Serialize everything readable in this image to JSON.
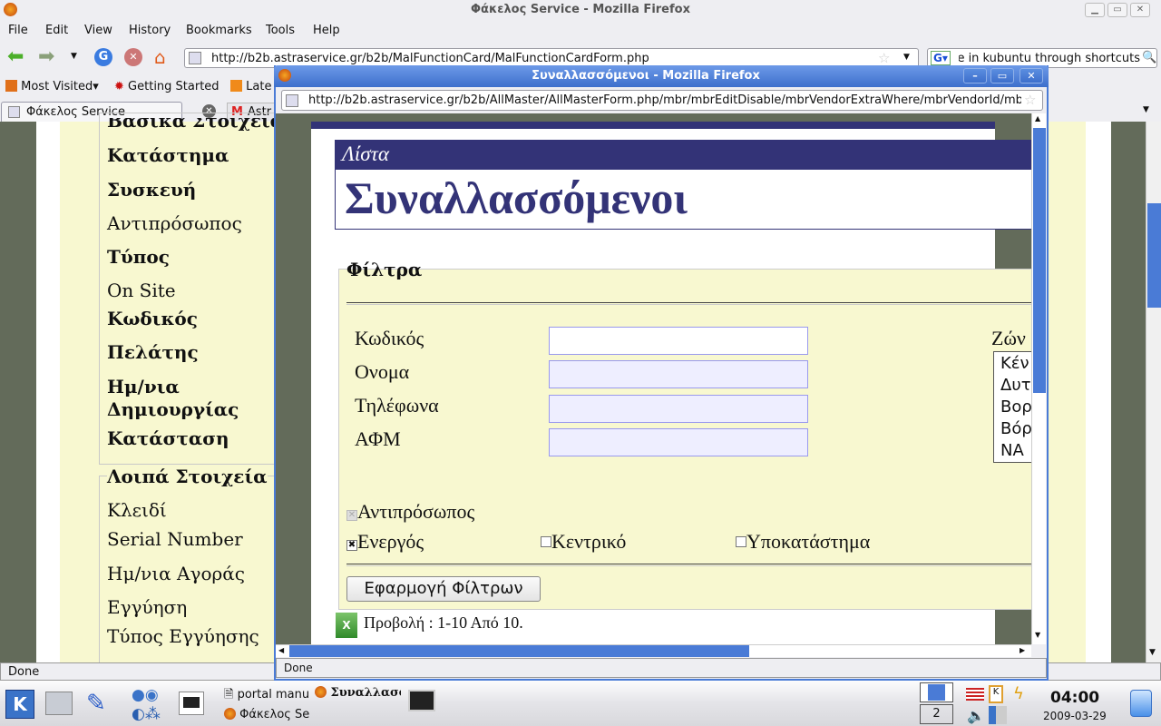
{
  "main_window": {
    "title": "Φάκελος Service - Mozilla Firefox",
    "menu": [
      "File",
      "Edit",
      "View",
      "History",
      "Bookmarks",
      "Tools",
      "Help"
    ],
    "url": "http://b2b.astraservice.gr/b2b/MalFunctionCard/MalFunctionCardForm.php",
    "search_value": "e in kubuntu through shortcuts",
    "bookmarks": [
      "Most Visited",
      "Getting Started",
      "Late"
    ],
    "tabs": [
      "Φάκελος Service",
      "Astr"
    ],
    "status": "Done",
    "sidebar_group1": {
      "legend": "Βασικά Στοιχεία",
      "items": [
        {
          "label": "Κατάστημα",
          "bold": true
        },
        {
          "label": "Συσκευή",
          "bold": true
        },
        {
          "label": "Αντιπρόσωπος",
          "bold": false
        },
        {
          "label": "Τύπος",
          "bold": true
        },
        {
          "label": "On Site",
          "bold": false
        },
        {
          "label": "Κωδικός",
          "bold": true
        },
        {
          "label": "Πελάτης",
          "bold": true
        },
        {
          "label": "Ημ/νια",
          "bold": true
        },
        {
          "label": "Δημιουργίας",
          "bold": true
        },
        {
          "label": "Κατάσταση",
          "bold": true
        }
      ]
    },
    "sidebar_group2": {
      "legend": "Λοιπά Στοιχεία",
      "items": [
        "Κλειδί",
        "Serial Number",
        "Ημ/νια Αγοράς",
        "Εγγύηση",
        "Τύπος Εγγύησης"
      ]
    }
  },
  "popup": {
    "title": "Συναλλασσόμενοι - Mozilla Firefox",
    "url": "http://b2b.astraservice.gr/b2b/AllMaster/AllMasterForm.php/mbr/mbrEditDisable/mbrVendorExtraWhere/mbrVendorId/mbrVendo",
    "banner": "Λίστα",
    "heading": "Συναλλασσόμενοι",
    "filters": {
      "legend": "Φίλτρα",
      "fields": [
        {
          "label": "Κωδικός",
          "value": ""
        },
        {
          "label": "Ονομα",
          "value": ""
        },
        {
          "label": "Τηλέφωνα",
          "value": ""
        },
        {
          "label": "ΑΦΜ",
          "value": ""
        }
      ],
      "zone_label": "Ζών",
      "zone_options": [
        "Κέν",
        "Δυτ",
        "Βορ",
        "Βόρ",
        "NA"
      ],
      "checkboxes": [
        {
          "label": "Αντιπρόσωπος",
          "checked": true,
          "disabled": true
        },
        {
          "label": "Ενεργός",
          "checked": true
        },
        {
          "label": "Κεντρικό",
          "checked": false
        },
        {
          "label": "Υποκατάστημα",
          "checked": false
        }
      ],
      "apply_button": "Εφαρμογή Φίλτρων"
    },
    "paging": "Προβολή : 1-10 Από 10.",
    "status": "Done",
    "colors": {
      "navy": "#333377",
      "filter_bg": "#f8f8d0",
      "titlebar": "#4a7bd6"
    }
  },
  "taskbar": {
    "tasks": [
      "portal manu",
      "Συναλλασσ",
      "Φάκελος Se"
    ],
    "desktop": "2",
    "clock": "04:00",
    "date": "2009-03-29"
  }
}
